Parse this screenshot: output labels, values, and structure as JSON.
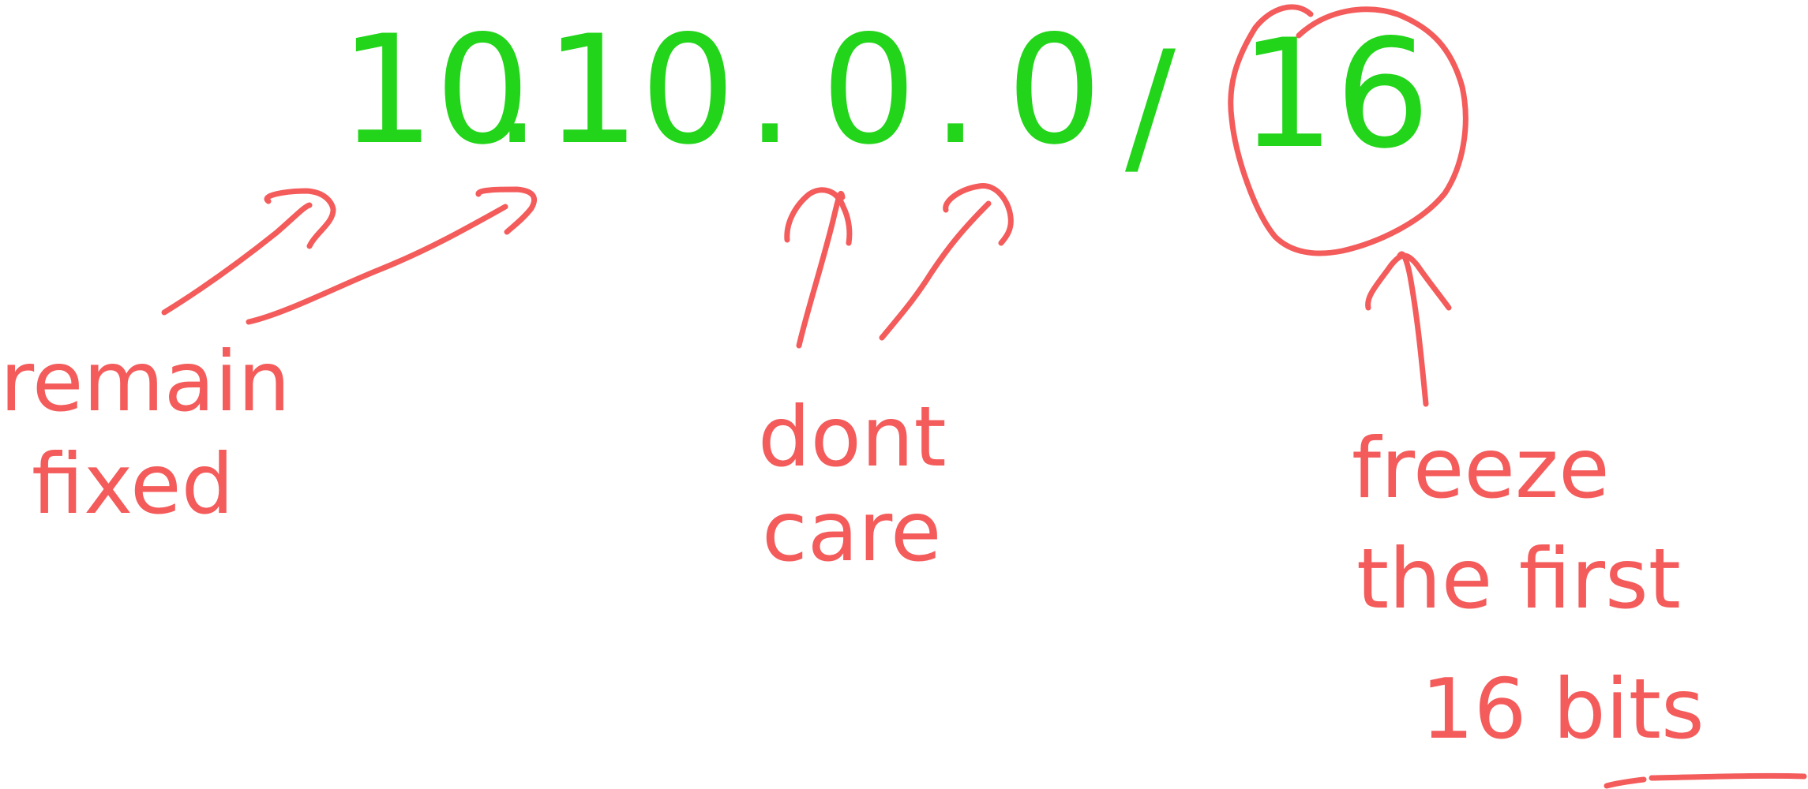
{
  "ip": {
    "octet1": "10",
    "octet2": "10",
    "octet3": "0",
    "octet4": "0",
    "dot": ".",
    "slash": "/",
    "prefix": "16"
  },
  "annotations": {
    "fixed_line1": "remain",
    "fixed_line2": "fixed",
    "dontcare_line1": "dont",
    "dontcare_line2": "care",
    "freeze_line1": "freeze",
    "freeze_line2": "the first",
    "freeze_line3": "16 bits"
  },
  "colors": {
    "ip_green": "#22d41a",
    "note_red": "#f45b5b",
    "background": "#ffffff"
  }
}
